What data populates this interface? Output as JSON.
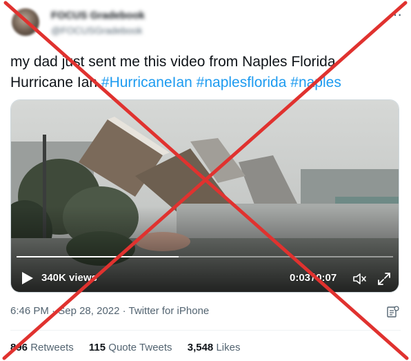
{
  "author": {
    "name": "FOCUS Gradebook",
    "handle": "@FOCUSGradebook"
  },
  "more_icon": "more-icon",
  "tweet": {
    "text_before": "my dad just sent me this video from Naples Florida Hurricane Ian ",
    "hashtags": [
      "#HurricaneIan",
      "#naplesflorida",
      "#naples"
    ]
  },
  "video": {
    "views": "340K views",
    "current_time": "0:03",
    "separator": "/",
    "duration": "0:07",
    "progress": 0.43
  },
  "meta": {
    "time": "6:46 PM",
    "dot1": " · ",
    "date": "Sep 28, 2022",
    "dot2": " · ",
    "source": "Twitter for iPhone"
  },
  "stats": {
    "retweets_count": "896",
    "retweets_label": "Retweets",
    "quotes_count": "115",
    "quotes_label": "Quote Tweets",
    "likes_count": "3,548",
    "likes_label": "Likes"
  },
  "overlay": {
    "cross_color": "#e0322f"
  }
}
